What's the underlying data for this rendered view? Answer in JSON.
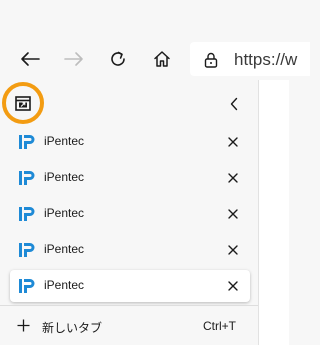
{
  "toolbar": {
    "back_icon": "back-arrow-icon",
    "forward_icon": "forward-arrow-icon",
    "refresh_icon": "refresh-icon",
    "home_icon": "home-icon",
    "address": {
      "lock_icon": "lock-icon",
      "url_text": "https://w"
    }
  },
  "vertical_tabs": {
    "header": {
      "layout_icon": "tab-layout-icon",
      "collapse_icon": "chevron-left-icon"
    },
    "tabs": [
      {
        "title": "iPentec",
        "favicon": "ipentec-logo-icon",
        "close_icon": "close-icon",
        "active": false
      },
      {
        "title": "iPentec",
        "favicon": "ipentec-logo-icon",
        "close_icon": "close-icon",
        "active": false
      },
      {
        "title": "iPentec",
        "favicon": "ipentec-logo-icon",
        "close_icon": "close-icon",
        "active": false
      },
      {
        "title": "iPentec",
        "favicon": "ipentec-logo-icon",
        "close_icon": "close-icon",
        "active": false
      },
      {
        "title": "iPentec",
        "favicon": "ipentec-logo-icon",
        "close_icon": "close-icon",
        "active": true
      }
    ],
    "new_tab": {
      "icon": "plus-icon",
      "label": "新しいタブ",
      "shortcut": "Ctrl+T"
    }
  },
  "colors": {
    "highlight_ring": "#f39c12",
    "favicon_blue": "#1e8ad6",
    "background": "#f7f7f7"
  }
}
